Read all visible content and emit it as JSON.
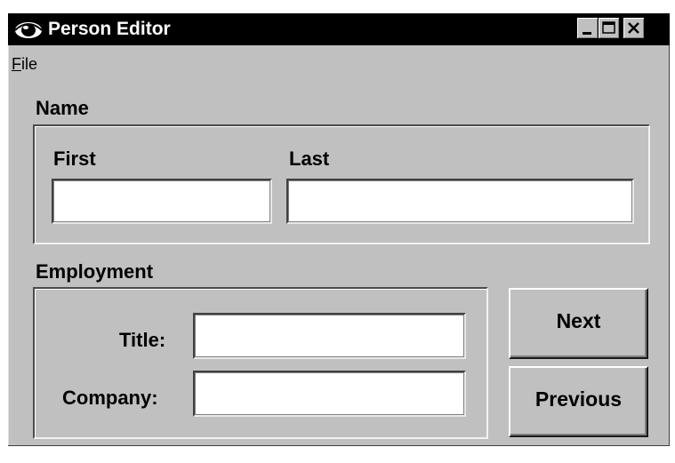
{
  "window": {
    "title": "Person Editor",
    "icon": "eye-icon",
    "controls": {
      "minimize": "minimize-icon",
      "maximize": "maximize-icon",
      "close": "close-icon"
    }
  },
  "menu": {
    "file": "File"
  },
  "name_group": {
    "label": "Name",
    "first_label": "First",
    "first_value": "",
    "last_label": "Last",
    "last_value": ""
  },
  "employment_group": {
    "label": "Employment",
    "title_label": "Title:",
    "title_value": "",
    "company_label": "Company:",
    "company_value": ""
  },
  "buttons": {
    "next": "Next",
    "previous": "Previous"
  }
}
